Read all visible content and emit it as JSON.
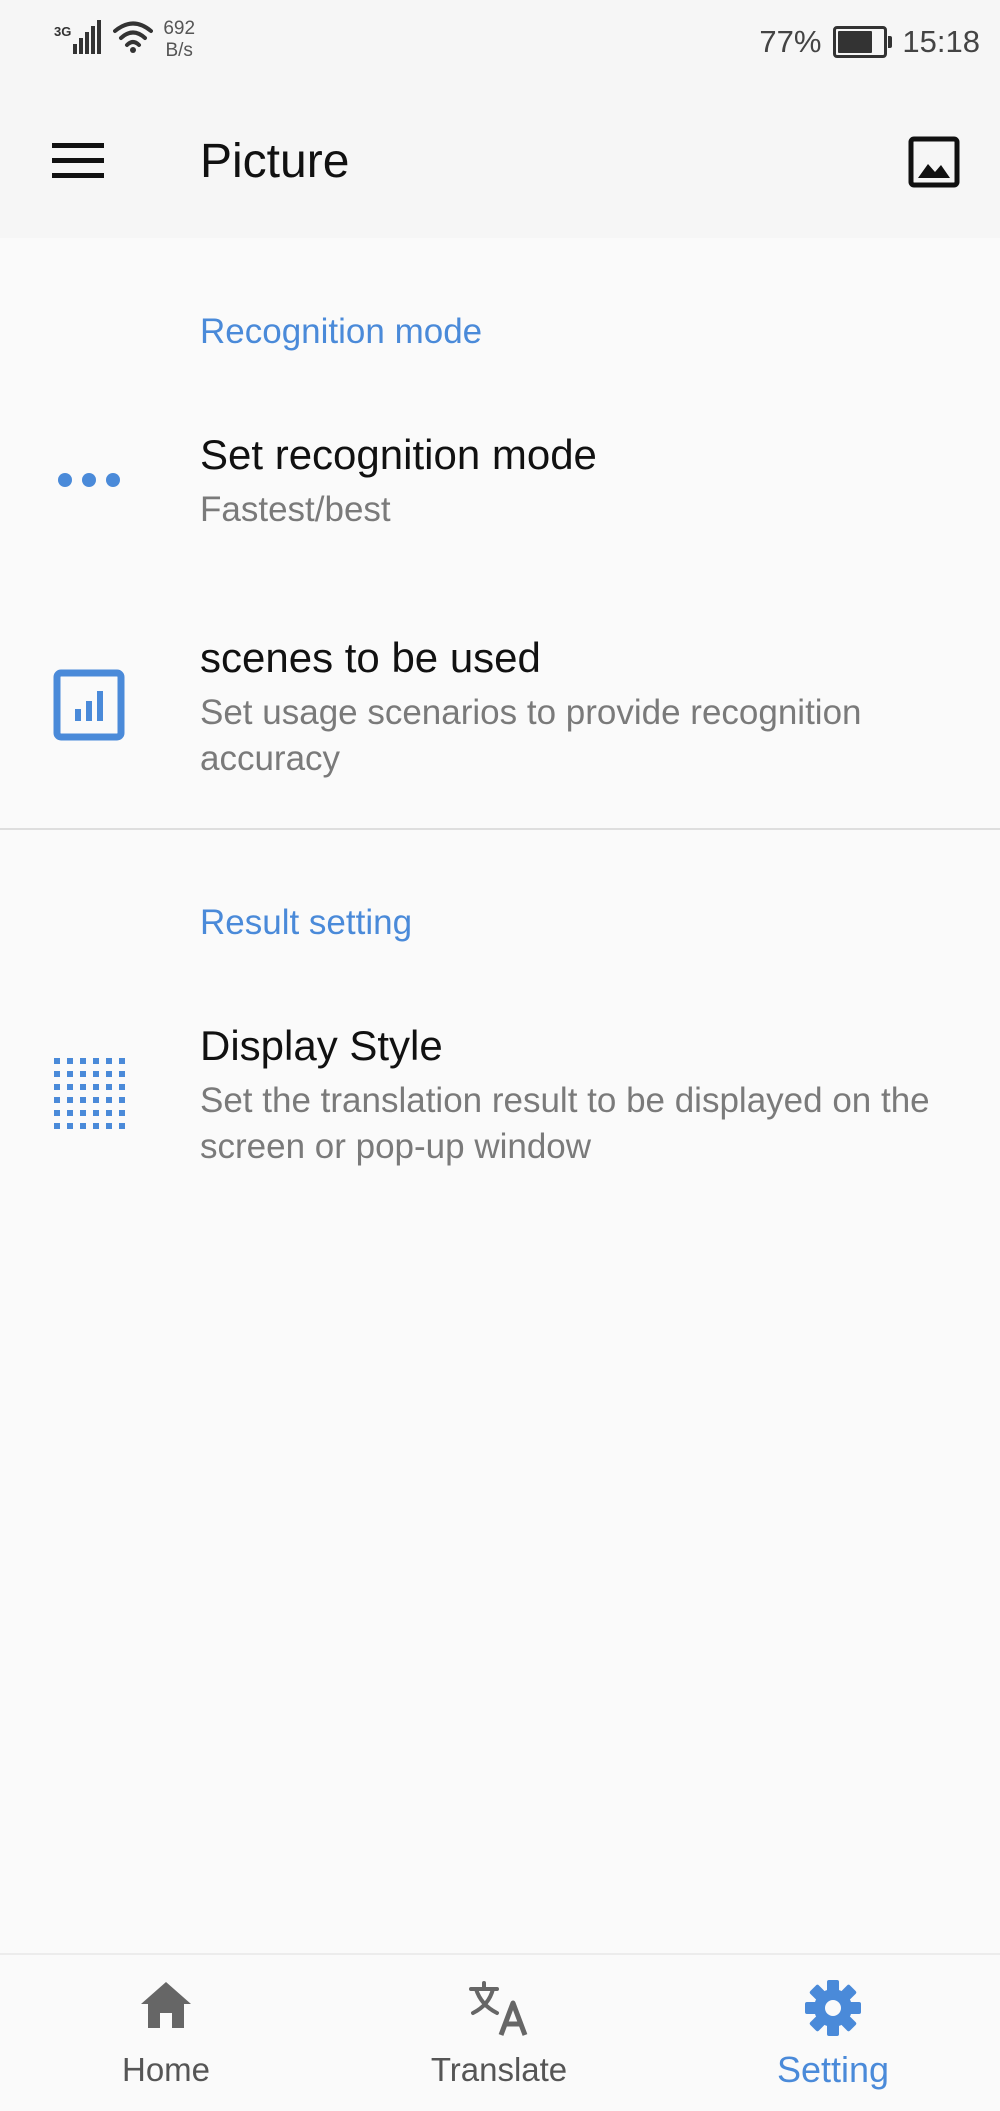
{
  "status_bar": {
    "network_type": "3G",
    "net_speed_value": "692",
    "net_speed_unit": "B/s",
    "battery_percent": "77%",
    "battery_level": 0.77,
    "time": "15:18"
  },
  "app_bar": {
    "title": "Picture"
  },
  "sections": {
    "recognition": {
      "header": "Recognition mode",
      "items": [
        {
          "title": "Set recognition mode",
          "subtitle": "Fastest/best",
          "icon": "more-dots-icon"
        },
        {
          "title": "scenes to be used",
          "subtitle": "Set usage scenarios to provide recognition accuracy",
          "icon": "bar-chart-icon"
        }
      ]
    },
    "result": {
      "header": "Result setting",
      "items": [
        {
          "title": "Display Style",
          "subtitle": "Set the translation result to be displayed on the screen or pop-up window",
          "icon": "dotted-grid-icon"
        }
      ]
    }
  },
  "bottom_nav": {
    "items": [
      {
        "label": "Home",
        "icon": "home-icon",
        "active": false
      },
      {
        "label": "Translate",
        "icon": "translate-icon",
        "active": false
      },
      {
        "label": "Setting",
        "icon": "gear-icon",
        "active": true
      }
    ]
  },
  "colors": {
    "accent": "#4a8ad9",
    "background": "#fafafa",
    "app_bar": "#f6f6f6",
    "text_primary": "#111111",
    "text_secondary": "#7a7a7a"
  }
}
